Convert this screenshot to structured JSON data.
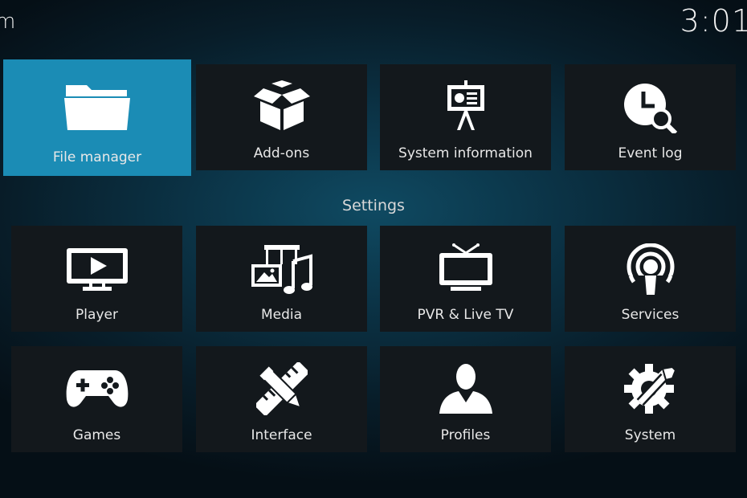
{
  "header": {
    "title": "m",
    "clock": "3:01"
  },
  "top_row": [
    {
      "label": "File manager",
      "icon": "folder-icon",
      "focused": true
    },
    {
      "label": "Add-ons",
      "icon": "open-box-icon"
    },
    {
      "label": "System information",
      "icon": "presentation-board-icon"
    },
    {
      "label": "Event log",
      "icon": "clock-magnifier-icon"
    }
  ],
  "settings": {
    "title": "Settings",
    "items": [
      {
        "label": "Player",
        "icon": "monitor-play-icon"
      },
      {
        "label": "Media",
        "icon": "media-icon"
      },
      {
        "label": "PVR & Live TV",
        "icon": "tv-antenna-icon"
      },
      {
        "label": "Services",
        "icon": "broadcast-icon"
      },
      {
        "label": "Games",
        "icon": "gamepad-icon"
      },
      {
        "label": "Interface",
        "icon": "pencil-ruler-icon"
      },
      {
        "label": "Profiles",
        "icon": "user-silhouette-icon"
      },
      {
        "label": "System",
        "icon": "gear-wrench-icon"
      }
    ]
  },
  "colors": {
    "focus": "#1b8cb5",
    "tile": "#13181c"
  }
}
